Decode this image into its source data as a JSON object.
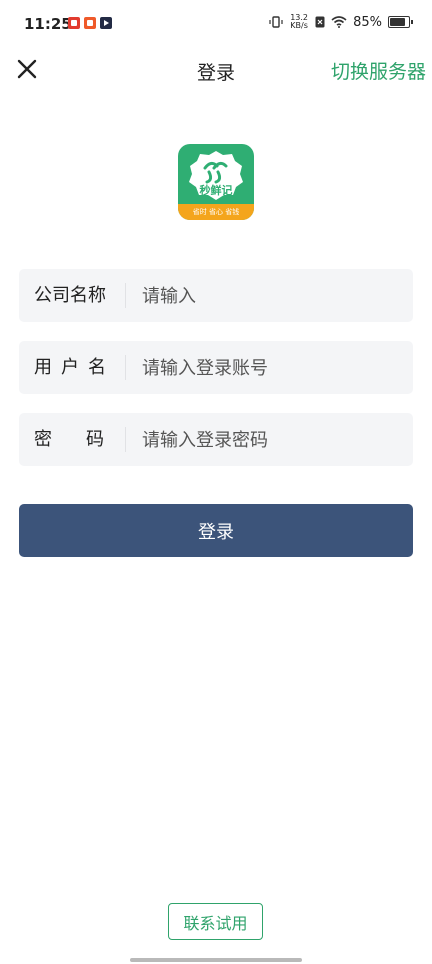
{
  "status_bar": {
    "time": "11:25",
    "net_speed_value": "13.2",
    "net_speed_unit": "KB/s",
    "battery": "85%"
  },
  "header": {
    "title": "登录",
    "switch_server": "切换服务器"
  },
  "logo": {
    "name": "秒鲜记",
    "slogan": "省时 省心 省钱"
  },
  "form": {
    "company": {
      "label": "公司名称",
      "placeholder": "请输入"
    },
    "username": {
      "label": "用户名",
      "placeholder": "请输入登录账号"
    },
    "password": {
      "label": "密码",
      "placeholder": "请输入登录密码"
    }
  },
  "login_button": "登录",
  "contact_button": "联系试用",
  "colors": {
    "accent_green": "#2fa36b",
    "login_button_bg": "#3c547a",
    "logo_orange": "#f4a51c"
  }
}
